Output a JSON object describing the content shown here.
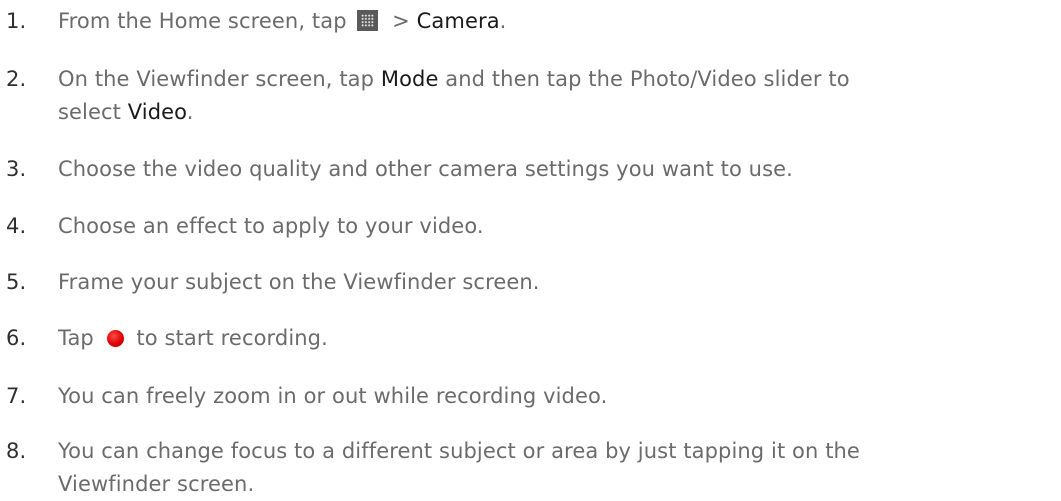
{
  "steps": [
    {
      "number": "1.",
      "parts": {
        "a": "From the Home screen, tap ",
        "icon": "apps-grid-icon",
        "b": " > ",
        "c": "Camera",
        "d": "."
      }
    },
    {
      "number": "2.",
      "parts": {
        "a": "On the Viewfinder screen, tap ",
        "b": "Mode",
        "c": " and then tap the Photo/Video slider to",
        "d": "select ",
        "e": "Video",
        "f": "."
      }
    },
    {
      "number": "3.",
      "text": "Choose the video quality and other camera settings you want to use."
    },
    {
      "number": "4.",
      "text": "Choose an effect to apply to your video."
    },
    {
      "number": "5.",
      "text": "Frame your subject on the Viewfinder screen."
    },
    {
      "number": "6.",
      "parts": {
        "a": "Tap ",
        "icon": "record-icon",
        "b": " to start recording."
      }
    },
    {
      "number": "7.",
      "text": "You can freely zoom in or out while recording video."
    },
    {
      "number": "8.",
      "line1": "You can change focus to a different subject or area by just tapping it on the",
      "line2": "Viewfinder screen."
    }
  ],
  "colors": {
    "body_text": "#6b6b6b",
    "emphasis_text": "#1a1a1a",
    "record_red": "#e00000"
  }
}
